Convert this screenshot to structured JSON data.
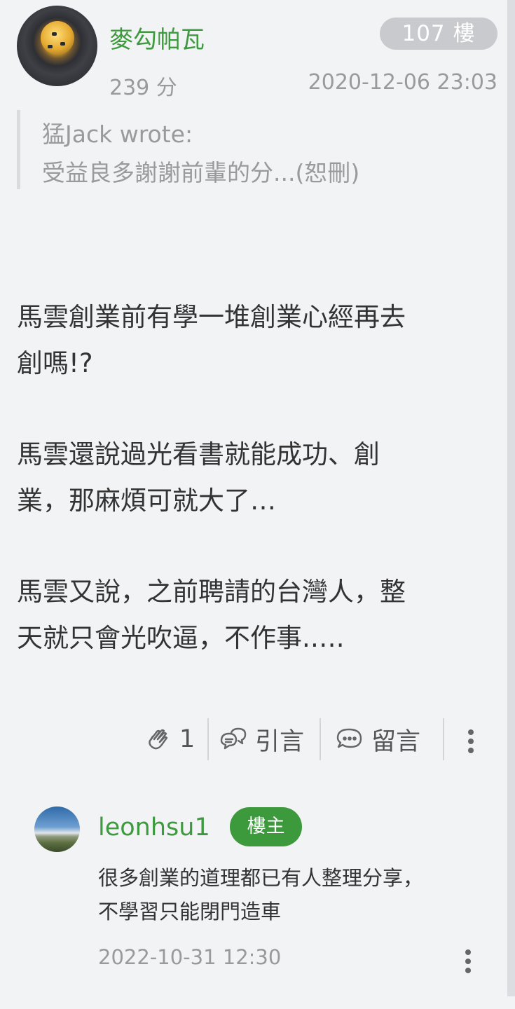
{
  "post": {
    "author": "麥勾帕瓦",
    "floor": "107 樓",
    "score": "239 分",
    "timestamp": "2020-12-06 23:03",
    "quote": {
      "author_line": "猛Jack wrote:",
      "text": "受益良多謝謝前輩的分...(恕刪)"
    },
    "paragraphs": [
      "馬雲創業前有學一堆創業心經再去\n創嗎!?",
      "馬雲還說過光看書就能成功、創\n業，那麻煩可就大了…",
      "馬雲又說，之前聘請的台灣人，整\n天就只會光吹逼，不作事.…."
    ],
    "actions": {
      "like_count": "1",
      "quote_label": "引言",
      "comment_label": "留言"
    }
  },
  "comment": {
    "author": "leonhsu1",
    "badge": "樓主",
    "text": "很多創業的道理都已有人整理分享，\n不學習只能閉門造車",
    "timestamp": "2022-10-31 12:30"
  },
  "colors": {
    "username_green": "#3e9a3e",
    "badge_green": "#3c9a3c",
    "background": "#f2f3f5",
    "muted_text": "#9a9a9a"
  },
  "icons": [
    "clap-icon",
    "quote-bubble-icon",
    "comment-bubble-icon",
    "more-vertical-icon"
  ]
}
